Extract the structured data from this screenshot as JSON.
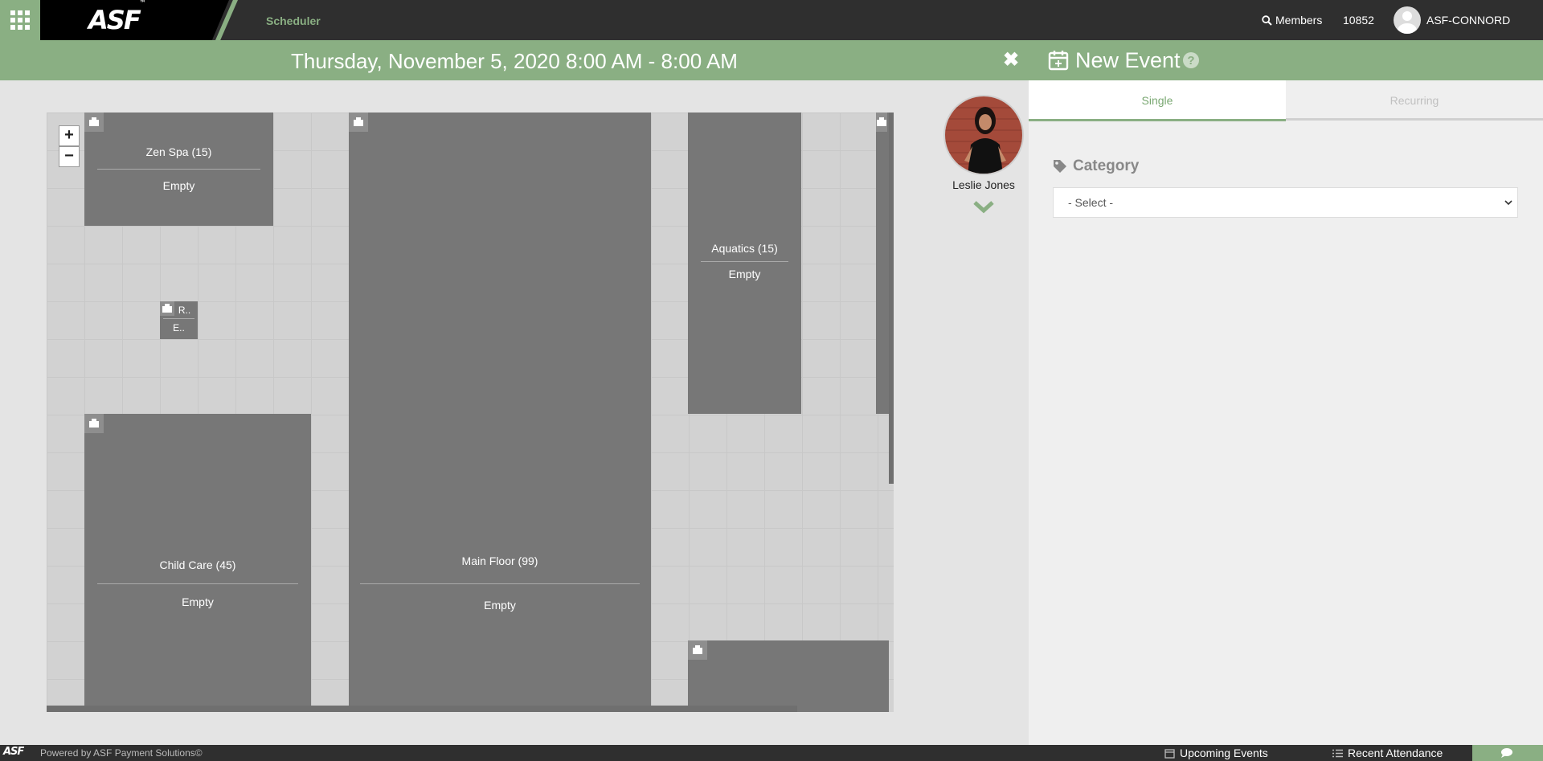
{
  "header": {
    "brand": "ASF",
    "app_title": "Scheduler",
    "members_label": "Members",
    "member_count": "10852",
    "username": "ASF-CONNORD"
  },
  "schedule": {
    "date_range": "Thursday, November 5, 2020 8:00 AM - 8:00 AM"
  },
  "map": {
    "zoom_in": "+",
    "zoom_out": "−",
    "rooms": [
      {
        "name": "Zen Spa (15)",
        "status": "Empty"
      },
      {
        "name": "R..",
        "status": "E.."
      },
      {
        "name": "Child Care (45)",
        "status": "Empty"
      },
      {
        "name": "Main Floor (99)",
        "status": "Empty"
      },
      {
        "name": "Aquatics (15)",
        "status": "Empty"
      }
    ]
  },
  "trainer": {
    "name": "Leslie Jones"
  },
  "panel": {
    "title": "New Event",
    "tabs": [
      "Single",
      "Recurring"
    ],
    "category_label": "Category",
    "category_select": "- Select -"
  },
  "footer": {
    "brand": "ASF",
    "powered": "Powered by ASF Payment Solutions©",
    "upcoming": "Upcoming Events",
    "attendance": "Recent Attendance"
  },
  "colors": {
    "accent": "#8aaf83",
    "topbar": "#2f2f2f",
    "room": "#777777"
  }
}
